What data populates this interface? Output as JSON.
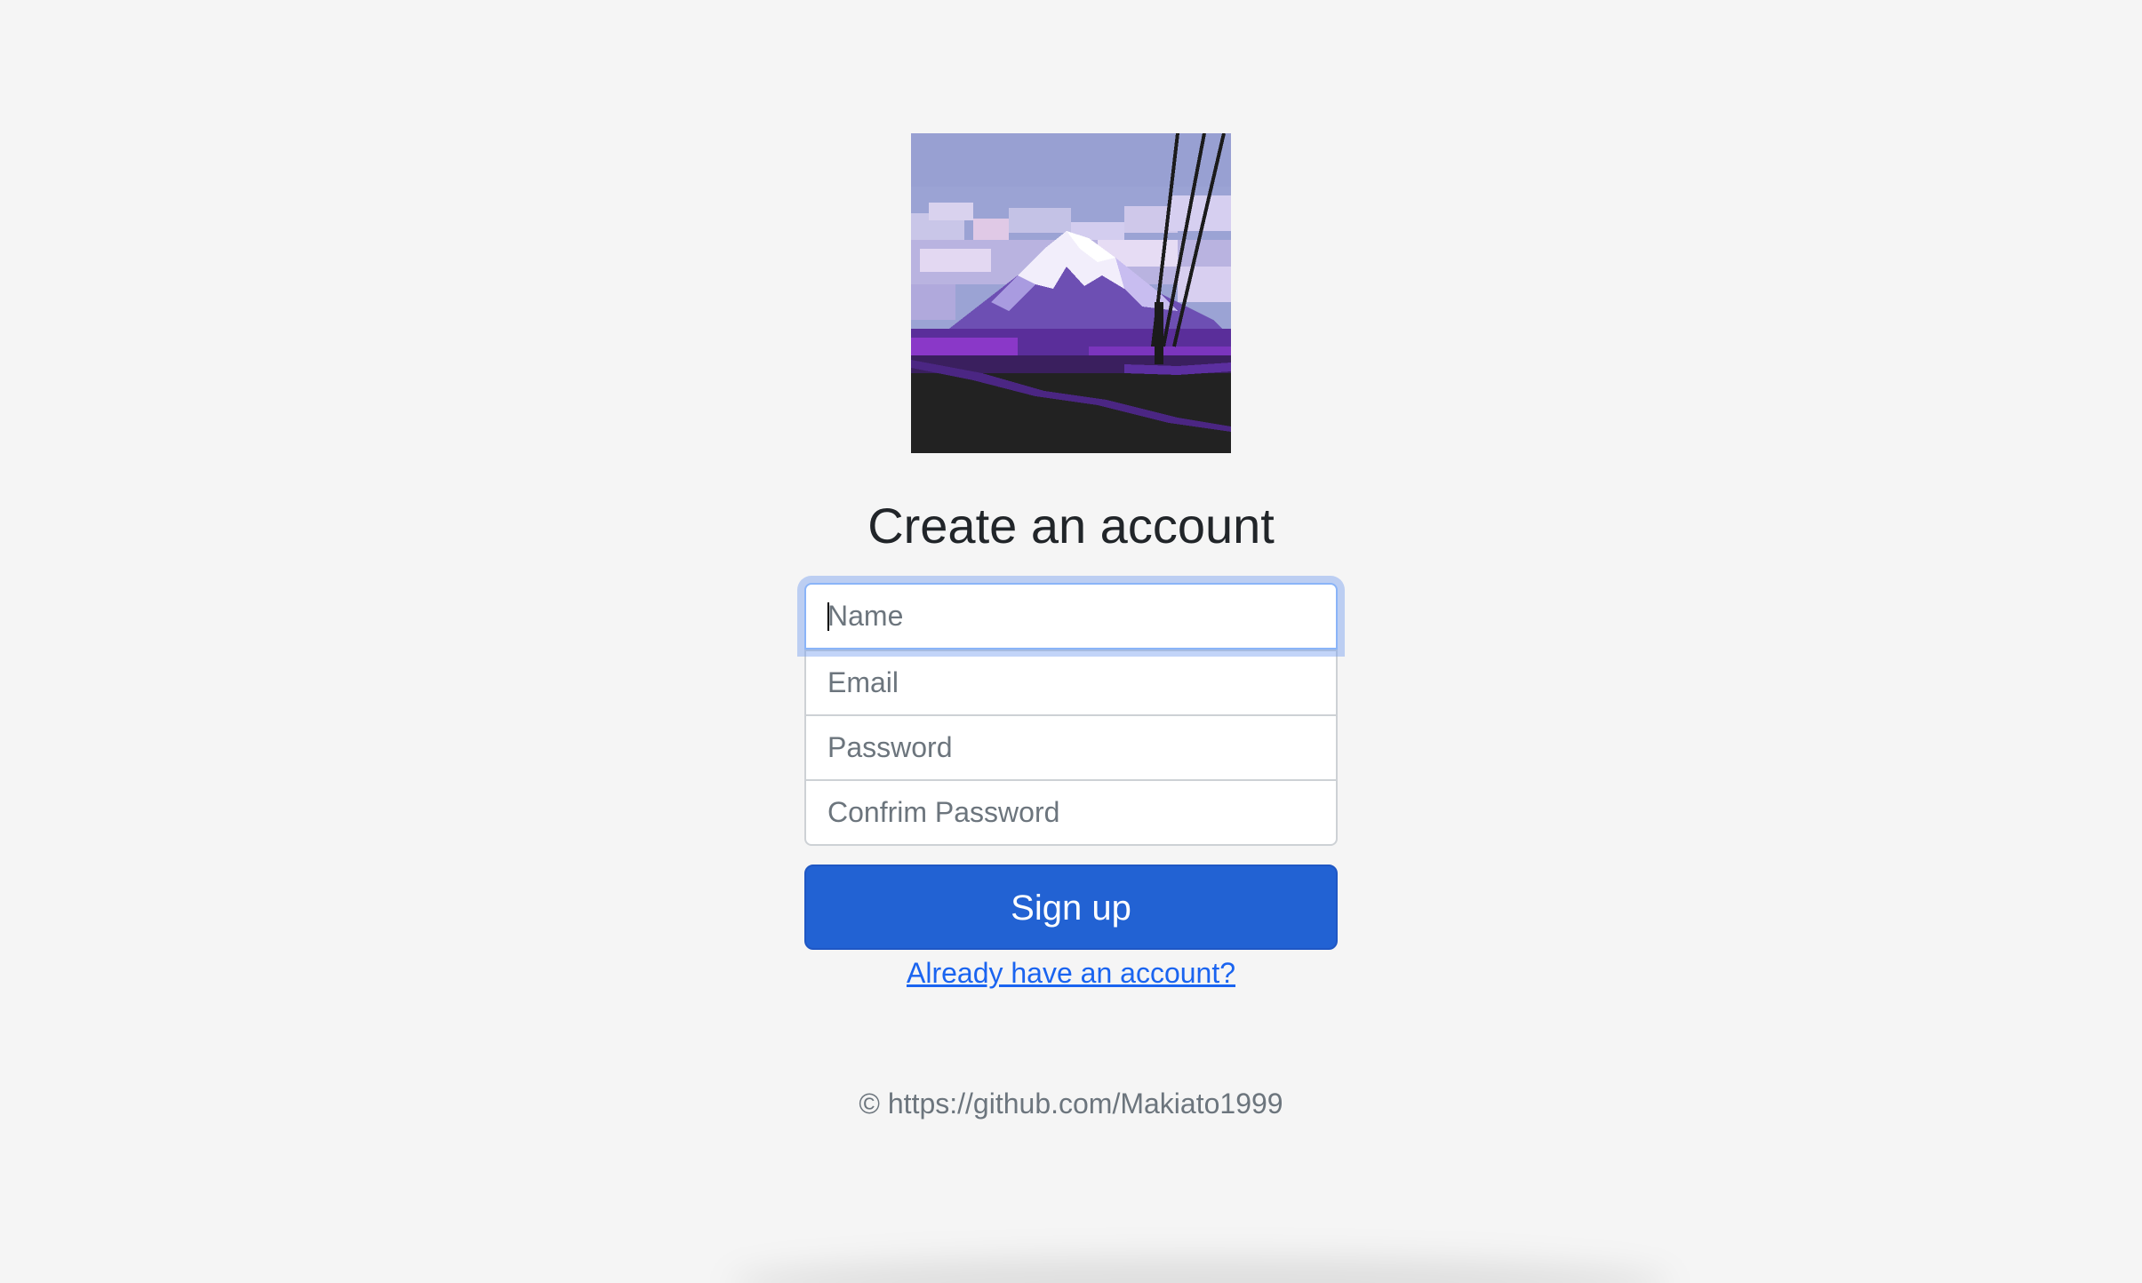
{
  "logo": {
    "icon": "pixel-art-mountain-image",
    "colors": {
      "sky": "#9ba3d4",
      "cloud": "#d9d2ee",
      "mountain": "#6d4fb3",
      "snow": "#f2eefb",
      "ground": "#222222",
      "accent": "#8a38c8"
    }
  },
  "heading": "Create an account",
  "form": {
    "name_placeholder": "Name",
    "email_placeholder": "Email",
    "password_placeholder": "Password",
    "confirm_placeholder": "Confrim Password",
    "submit_label": "Sign up",
    "login_link": "Already have an account?"
  },
  "footer": {
    "text": "© https://github.com/Makiato1999"
  },
  "colors": {
    "background": "#f5f5f5",
    "primary": "#2262d3",
    "link": "#1a64f0",
    "focus_ring": "#8ab4f8"
  }
}
